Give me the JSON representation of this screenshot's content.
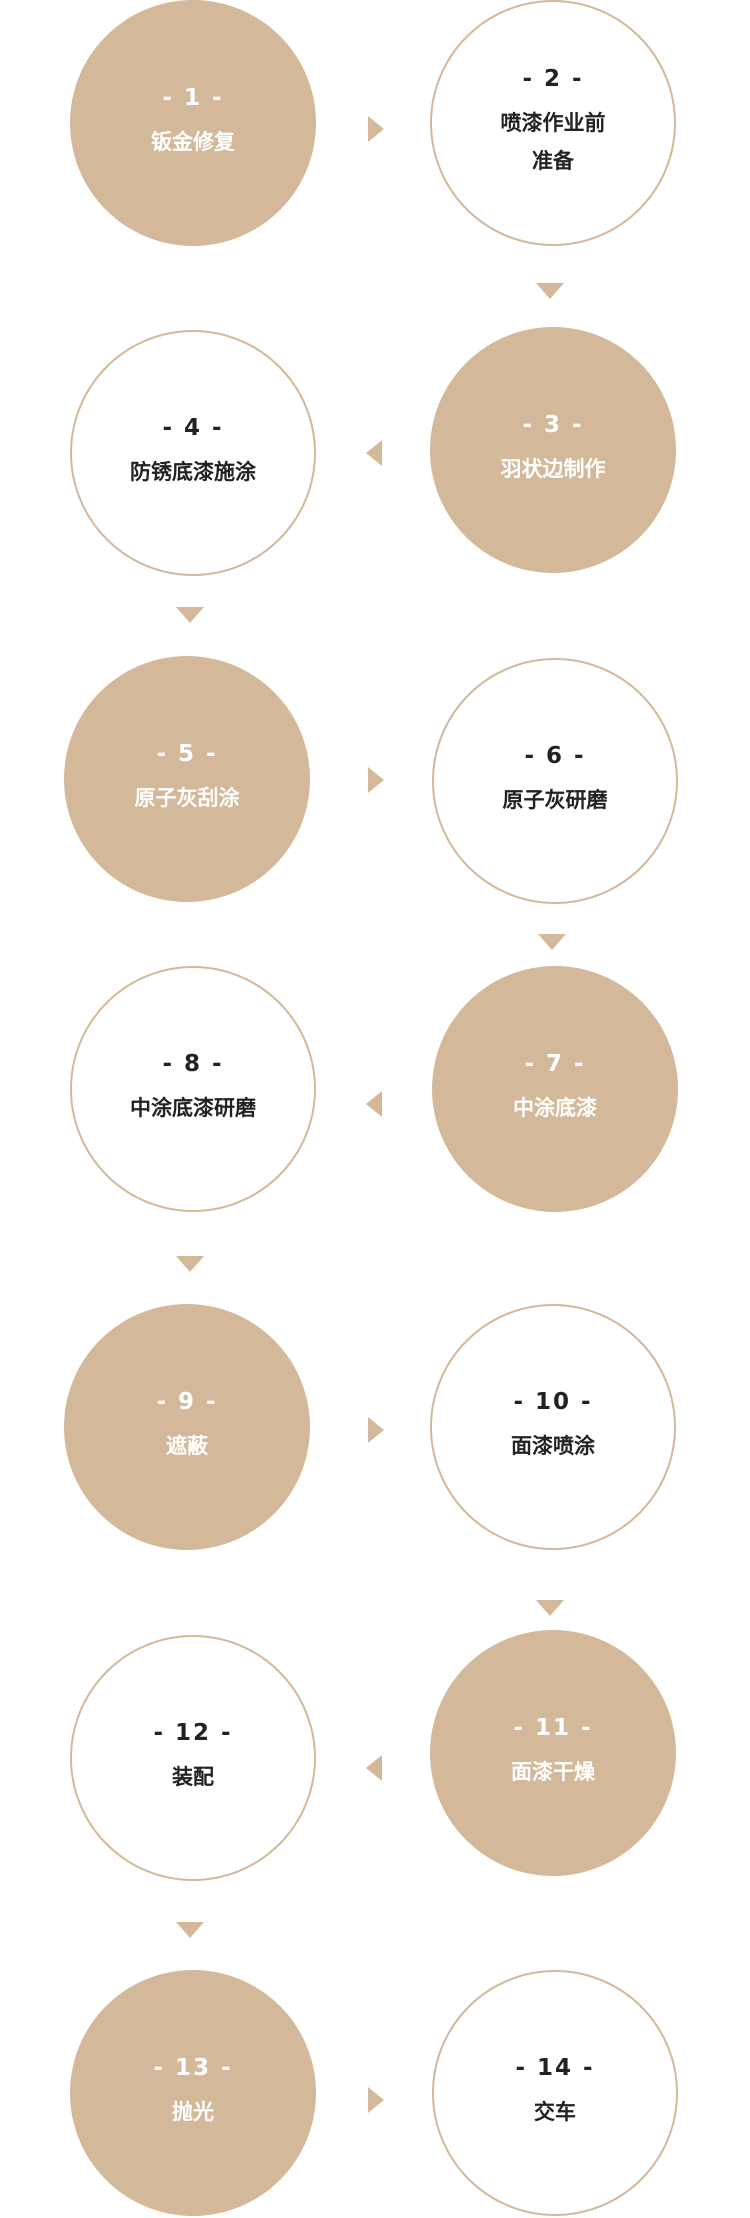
{
  "steps": [
    {
      "num": "- 1 -",
      "title": "钣金修复"
    },
    {
      "num": "- 2 -",
      "title": "喷漆作业前\n准备"
    },
    {
      "num": "- 3 -",
      "title": "羽状边制作"
    },
    {
      "num": "- 4 -",
      "title": "防锈底漆施涂"
    },
    {
      "num": "- 5 -",
      "title": "原子灰刮涂"
    },
    {
      "num": "- 6 -",
      "title": "原子灰研磨"
    },
    {
      "num": "- 7 -",
      "title": "中涂底漆"
    },
    {
      "num": "- 8 -",
      "title": "中涂底漆研磨"
    },
    {
      "num": "- 9 -",
      "title": "遮蔽"
    },
    {
      "num": "- 10 -",
      "title": "面漆喷涂"
    },
    {
      "num": "- 11 -",
      "title": "面漆干燥"
    },
    {
      "num": "- 12 -",
      "title": "装配"
    },
    {
      "num": "- 13 -",
      "title": "抛光"
    },
    {
      "num": "- 14 -",
      "title": "交车"
    }
  ],
  "colors": {
    "accent": "#d4b89a",
    "text_dark": "#222222",
    "text_light": "#ffffff"
  }
}
